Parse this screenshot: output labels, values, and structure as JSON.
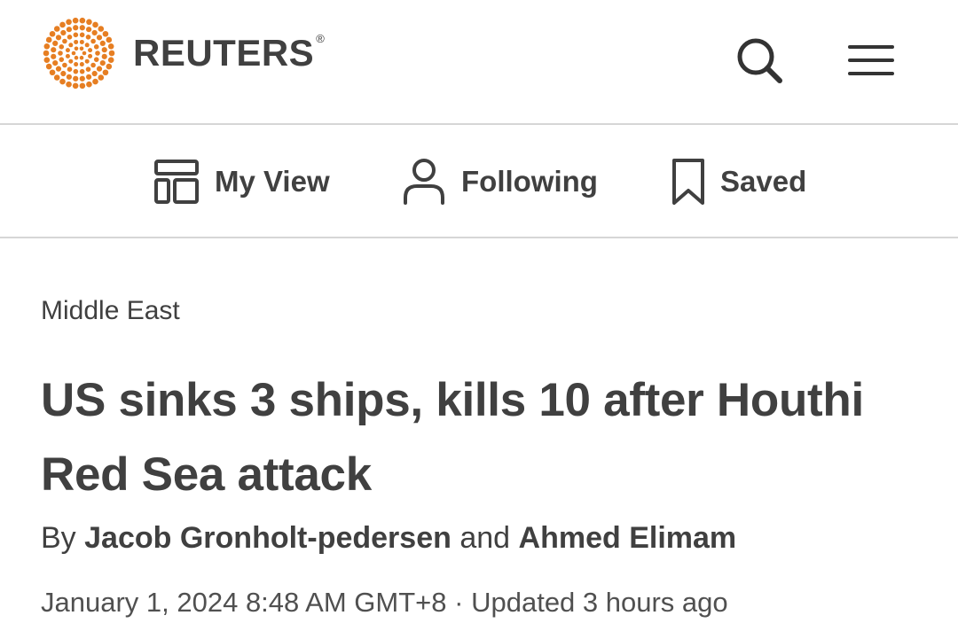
{
  "header": {
    "brand": "REUTERS",
    "brand_mark": "®",
    "logo_color": "#e67e22",
    "icons": {
      "logo": "reuters-dot-logo",
      "search": "search-icon",
      "menu": "hamburger-menu-icon"
    }
  },
  "nav": {
    "items": [
      {
        "label": "My View",
        "icon": "layout-icon"
      },
      {
        "label": "Following",
        "icon": "person-icon"
      },
      {
        "label": "Saved",
        "icon": "bookmark-icon"
      }
    ]
  },
  "article": {
    "section": "Middle East",
    "headline": "US sinks 3 ships, kills 10 after Houthi Red Sea attack",
    "byline": {
      "prefix": "By",
      "author1": "Jacob Gronholt-pedersen",
      "conjunction": "and",
      "author2": "Ahmed Elimam"
    },
    "date": "January 1, 2024 8:48 AM GMT+8",
    "separator": "·",
    "updated": "Updated 3 hours ago"
  },
  "colors": {
    "text": "#404040",
    "divider": "#d6d6d6",
    "accent": "#e67e22"
  }
}
